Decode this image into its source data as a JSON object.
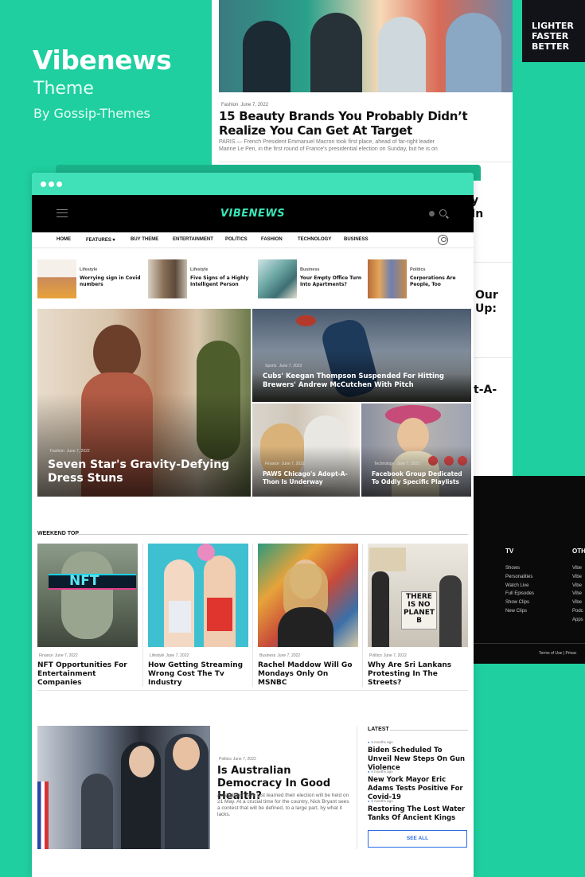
{
  "promo": {
    "title": "Vibenews",
    "subtitle": "Theme",
    "byline": "By Gossip-Themes"
  },
  "ad": {
    "lines": [
      "LIGHTER",
      "FASTER",
      "BETTER"
    ]
  },
  "bg_page": {
    "category": "Fashion",
    "date": "June 7, 2022",
    "headline": "15 Beauty Brands You Probably Didn’t Realize You Can Get At Target",
    "excerpt": "PARIS — French President Emmanuel Macron took first place, ahead of far-right leader Marine Le Pen, in the first round of France's presidential election on Sunday, but he is on",
    "fragments": [
      "y",
      "In",
      "Our",
      "Up:",
      "t-A-"
    ]
  },
  "dark_footer": {
    "col1": {
      "title": "TV",
      "items": [
        "Shows",
        "Personalities",
        "Watch Live",
        "Full Episodes",
        "Show Clips",
        "New Clips"
      ]
    },
    "col2": {
      "title": "OTH",
      "items": [
        "Vibe",
        "Vibe",
        "Vibe",
        "Vibe",
        "Vibe",
        "Podc",
        "Apps"
      ]
    },
    "terms": "Terms of Use  |  Privac"
  },
  "site": {
    "logo": "VIBENEWS",
    "nav": [
      "HOME",
      "FEATURES ▾",
      "BUY THEME",
      "ENTERTAINMENT",
      "POLITICS",
      "FASHION",
      "TECHNOLOGY",
      "BUSINESS"
    ]
  },
  "mini_posts": [
    {
      "category": "Lifestyle",
      "title": "Worrying sign in Covid numbers"
    },
    {
      "category": "Lifestyle",
      "title": "Five Signs of a Highly Intelligent Person"
    },
    {
      "category": "Business",
      "title": "Your Empty Office Turn Into Apartments?"
    },
    {
      "category": "Politics",
      "title": "Corporations Are People, Too"
    }
  ],
  "hero": {
    "main": {
      "category": "Fashion",
      "date": "June 7, 2022",
      "title": "Seven Star's Gravity-Defying Dress Stuns"
    },
    "top_right": {
      "category": "Sports",
      "date": "June 7, 2022",
      "title": "Cubs' Keegan Thompson Suspended For Hitting Brewers' Andrew McCutchen With Pitch"
    },
    "bottom_left": {
      "category": "Finance",
      "date": "June 7, 2022",
      "title": "PAWS Chicago's Adopt-A-Thon Is Underway"
    },
    "bottom_right": {
      "category": "Technology",
      "date": "June 7, 2022",
      "title": "Facebook Group Dedicated To Oddly Specific Playlists"
    }
  },
  "weekend_top": {
    "title": "WEEKEND TOP",
    "items": [
      {
        "category": "Finance",
        "date": "June 7, 2022",
        "title": "NFT Opportunities For Entertainment Companies",
        "img_text": "NFT"
      },
      {
        "category": "Lifestyle",
        "date": "June 7, 2022",
        "title": "How Getting Streaming Wrong Cost The Tv Industry"
      },
      {
        "category": "Business",
        "date": "June 7, 2022",
        "title": "Rachel Maddow Will Go Mondays Only On MSNBC"
      },
      {
        "category": "Politics",
        "date": "June 7, 2022",
        "title": "Why Are Sri Lankans Protesting In The Streets?",
        "img_text": "THERE IS NO PLANET B"
      }
    ]
  },
  "featured": {
    "category": "Politics",
    "date": "June 7, 2022",
    "title": "Is Australian Democracy In Good Health?",
    "excerpt": "Australians have just learned their election will be held on 21 May. At a crucial time for the country, Nick Bryant sees a contest that will be defined, to a large part, by what it lacks."
  },
  "latest": {
    "title": "LATEST",
    "items": [
      {
        "time": "6 months ago",
        "title": "Biden Scheduled To Unveil New Steps On Gun Violence"
      },
      {
        "time": "6 months ago",
        "title": "New York Mayor Eric Adams Tests Positive For Covid-19"
      },
      {
        "time": "6 months ago",
        "title": "Restoring The Lost Water Tanks Of Ancient Kings"
      }
    ],
    "see_all": "SEE ALL"
  }
}
